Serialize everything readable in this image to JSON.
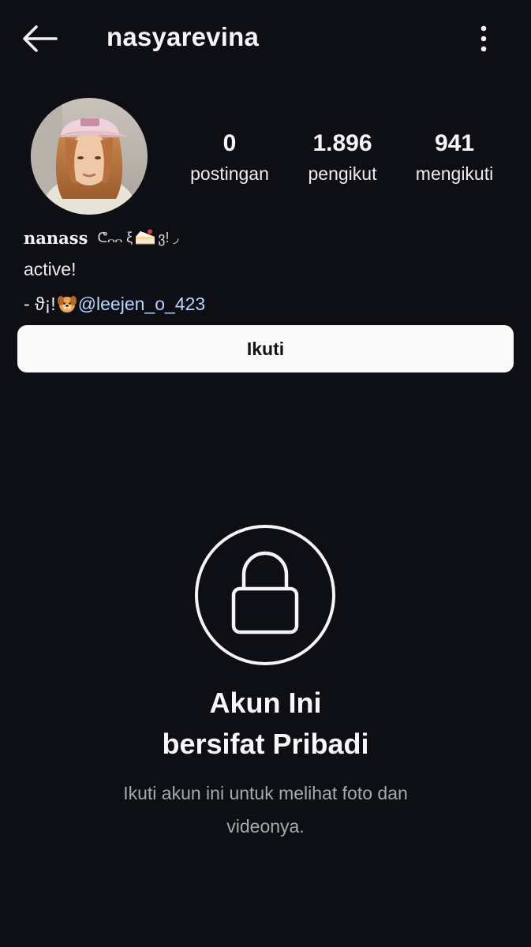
{
  "header": {
    "back_icon": "arrow-left-icon",
    "username": "nasyarevina",
    "more_icon": "more-vertical-icon"
  },
  "profile": {
    "avatar_icon": "avatar",
    "stats": [
      {
        "value": "0",
        "label": "postingan"
      },
      {
        "value": "1.896",
        "label": "pengikut"
      },
      {
        "value": "941",
        "label": "mengikuti"
      }
    ]
  },
  "bio": {
    "name": "nanass",
    "deco_left": "ᕦ᎔᎔ ξ",
    "deco_right": "ვ! ◞",
    "line1": "active!",
    "line2_prefix": "- ϑ¡!",
    "mention": "@leejen_o_423"
  },
  "follow_button": {
    "label": "Ikuti"
  },
  "private": {
    "icon": "lock-icon",
    "title_line1": "Akun Ini",
    "title_line2": "bersifat Pribadi",
    "subtitle": "Ikuti akun ini untuk melihat foto dan videonya."
  },
  "colors": {
    "background": "#0d0f14",
    "mention": "#b9d4ff",
    "button_bg": "#fafafa",
    "subtitle": "#a7a9ad"
  }
}
